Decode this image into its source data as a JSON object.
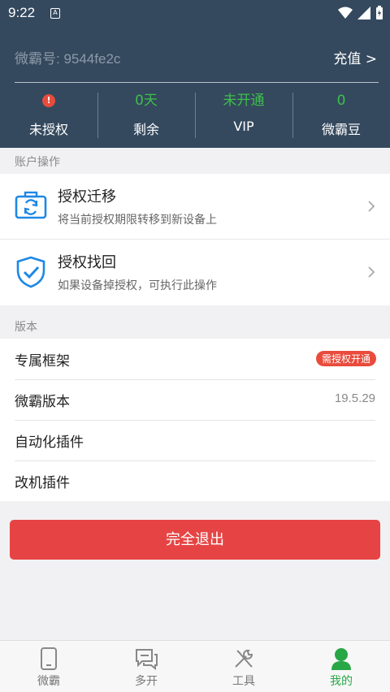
{
  "status_bar": {
    "time": "9:22",
    "sim_label": "A"
  },
  "header": {
    "account_id": "微霸号: 9544fe2c",
    "recharge_label": "充值 >",
    "stats": [
      {
        "value": "!",
        "label": "未授权",
        "value_icon": "warning-icon",
        "color": "#e74c3c"
      },
      {
        "value": "0天",
        "label": "剩余",
        "color": "#3cc04a"
      },
      {
        "value": "未开通",
        "label": "VIP",
        "color": "#3cc04a"
      },
      {
        "value": "0",
        "label": "微霸豆",
        "color": "#3cc04a"
      }
    ]
  },
  "account_ops": {
    "section_title": "账户操作",
    "items": [
      {
        "title": "授权迁移",
        "subtitle": "将当前授权期限转移到新设备上",
        "icon": "transfer-icon"
      },
      {
        "title": "授权找回",
        "subtitle": "如果设备掉授权，可执行此操作",
        "icon": "shield-check-icon"
      }
    ]
  },
  "version": {
    "section_title": "版本",
    "items": [
      {
        "title": "专属框架",
        "badge": "需授权开通"
      },
      {
        "title": "微霸版本",
        "value": "19.5.29"
      },
      {
        "title": "自动化插件"
      },
      {
        "title": "改机插件"
      }
    ]
  },
  "quit_label": "完全退出",
  "tabs": [
    {
      "label": "微霸",
      "icon": "phone-icon",
      "active": false
    },
    {
      "label": "多开",
      "icon": "chat-icon",
      "active": false
    },
    {
      "label": "工具",
      "icon": "tools-icon",
      "active": false
    },
    {
      "label": "我的",
      "icon": "person-icon",
      "active": true
    }
  ],
  "colors": {
    "header_bg": "#34495e",
    "accent_green": "#3cc04a",
    "danger_red": "#e64444",
    "icon_blue": "#1e88e5"
  }
}
